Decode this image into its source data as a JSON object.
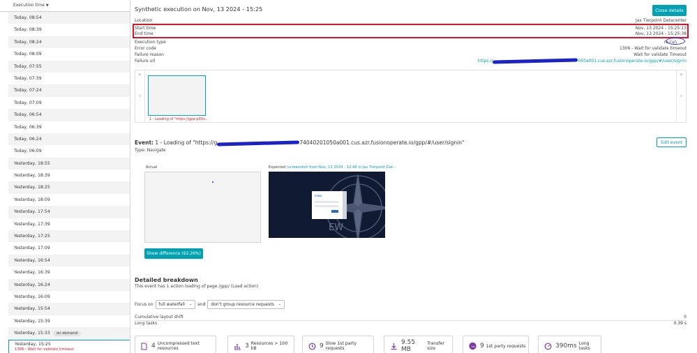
{
  "sidebar": {
    "header": "Execution time",
    "items": [
      {
        "time": "Today, 08:54",
        "badge": "",
        "sub": ""
      },
      {
        "time": "Today, 08:39",
        "badge": "",
        "sub": ""
      },
      {
        "time": "Today, 08:24",
        "badge": "",
        "sub": ""
      },
      {
        "time": "Today, 08:09",
        "badge": "",
        "sub": ""
      },
      {
        "time": "Today, 07:55",
        "badge": "",
        "sub": ""
      },
      {
        "time": "Today, 07:39",
        "badge": "",
        "sub": ""
      },
      {
        "time": "Today, 07:24",
        "badge": "",
        "sub": ""
      },
      {
        "time": "Today, 07:09",
        "badge": "",
        "sub": ""
      },
      {
        "time": "Today, 06:54",
        "badge": "",
        "sub": ""
      },
      {
        "time": "Today, 06:39",
        "badge": "",
        "sub": ""
      },
      {
        "time": "Today, 06:24",
        "badge": "",
        "sub": ""
      },
      {
        "time": "Today, 06:09",
        "badge": "",
        "sub": ""
      },
      {
        "time": "Yesterday, 18:55",
        "badge": "",
        "sub": ""
      },
      {
        "time": "Yesterday, 18:39",
        "badge": "",
        "sub": ""
      },
      {
        "time": "Yesterday, 18:25",
        "badge": "",
        "sub": ""
      },
      {
        "time": "Yesterday, 18:09",
        "badge": "",
        "sub": ""
      },
      {
        "time": "Yesterday, 17:54",
        "badge": "",
        "sub": ""
      },
      {
        "time": "Yesterday, 17:39",
        "badge": "",
        "sub": ""
      },
      {
        "time": "Yesterday, 17:25",
        "badge": "",
        "sub": ""
      },
      {
        "time": "Yesterday, 17:09",
        "badge": "",
        "sub": ""
      },
      {
        "time": "Yesterday, 16:54",
        "badge": "",
        "sub": ""
      },
      {
        "time": "Yesterday, 16:39",
        "badge": "",
        "sub": ""
      },
      {
        "time": "Yesterday, 16:24",
        "badge": "",
        "sub": ""
      },
      {
        "time": "Yesterday, 16:09",
        "badge": "",
        "sub": ""
      },
      {
        "time": "Yesterday, 15:54",
        "badge": "",
        "sub": ""
      },
      {
        "time": "Yesterday, 15:39",
        "badge": "",
        "sub": ""
      },
      {
        "time": "Yesterday, 15:33",
        "badge": "on-demand",
        "sub": ""
      },
      {
        "time": "Yesterday, 15:25",
        "badge": "",
        "sub": "1306 - Wait for validate timeout",
        "active": true
      }
    ]
  },
  "header": {
    "title": "Synthetic execution on Nov, 13 2024 - 15:25",
    "close_label": "Close details"
  },
  "props": {
    "location_label": "Location",
    "location_value": "Jax Tierpoint Datacenter",
    "start_label": "Start time",
    "start_value": "Nov, 13 2024 - 15:25:13",
    "end_label": "End time",
    "end_value": "Nov, 13 2024 - 15:25:38",
    "exec_type_label": "Execution type",
    "exec_type_value": "re-run",
    "error_code_label": "Error code",
    "error_code_value": "1306 - Wait for validate timeout",
    "failure_reason_label": "Failure reason",
    "failure_reason_value": "Wait for validate Timeout",
    "failure_url_label": "Failure url",
    "failure_url_start": "https://",
    "failure_url_end": "050a001.cus.azr.fusionoperate.io/gpp/#/user/signin"
  },
  "carousel": {
    "thumb_caption": "1 - Loading of \"https://gpp-p03v..."
  },
  "event": {
    "label": "Event:",
    "title_start": "1 - Loading of \"https://g",
    "title_end": "74040201050a001.cus.azr.fusionoperate.io/gpp/#/user/signin\"",
    "type": "Type: Navigate",
    "edit_label": "Edit event",
    "actual_label": "Actual",
    "expected_label": "Expected",
    "expected_link": "(screenshot from Nov, 13 2024 - 12:49 in Jax Tierpoint Dat...",
    "diff_label": "Show difference (92.26%)",
    "expected_brand": "ellaw",
    "expected_watermark": "EW"
  },
  "breakdown": {
    "title": "Detailed breakdown",
    "subtitle": "This event has 1 action loading of page /gpp/ (Load action)",
    "focus_label": "Focus on",
    "focus_value": "full waterfall",
    "and_label": "and",
    "group_value": "don't group resource requests",
    "cls_label": "Cumulative layout shift",
    "cls_value": "0",
    "long_tasks_label": "Long tasks",
    "long_tasks_value": "0.39 s"
  },
  "tiles": [
    {
      "icon": "document-icon",
      "num": "4",
      "label": "Uncompressed text resources"
    },
    {
      "icon": "resources-icon",
      "num": "3",
      "label": "Resources > 100 kB"
    },
    {
      "icon": "clock-icon",
      "num": "9",
      "label": "Slow 1st party requests"
    },
    {
      "icon": "download-icon",
      "num": "9.55 MB",
      "label": "Transfer size"
    },
    {
      "icon": "first-party-icon",
      "num": "9",
      "label": "1st party requests",
      "icon_text": "1st"
    },
    {
      "icon": "speedometer-icon",
      "num": "390ms",
      "label": "Long tasks"
    }
  ],
  "colors": {
    "accent": "#00a1b2",
    "error": "#dc172a",
    "highlight_box": "#e0112b",
    "annotation": "#2a2fd1"
  }
}
